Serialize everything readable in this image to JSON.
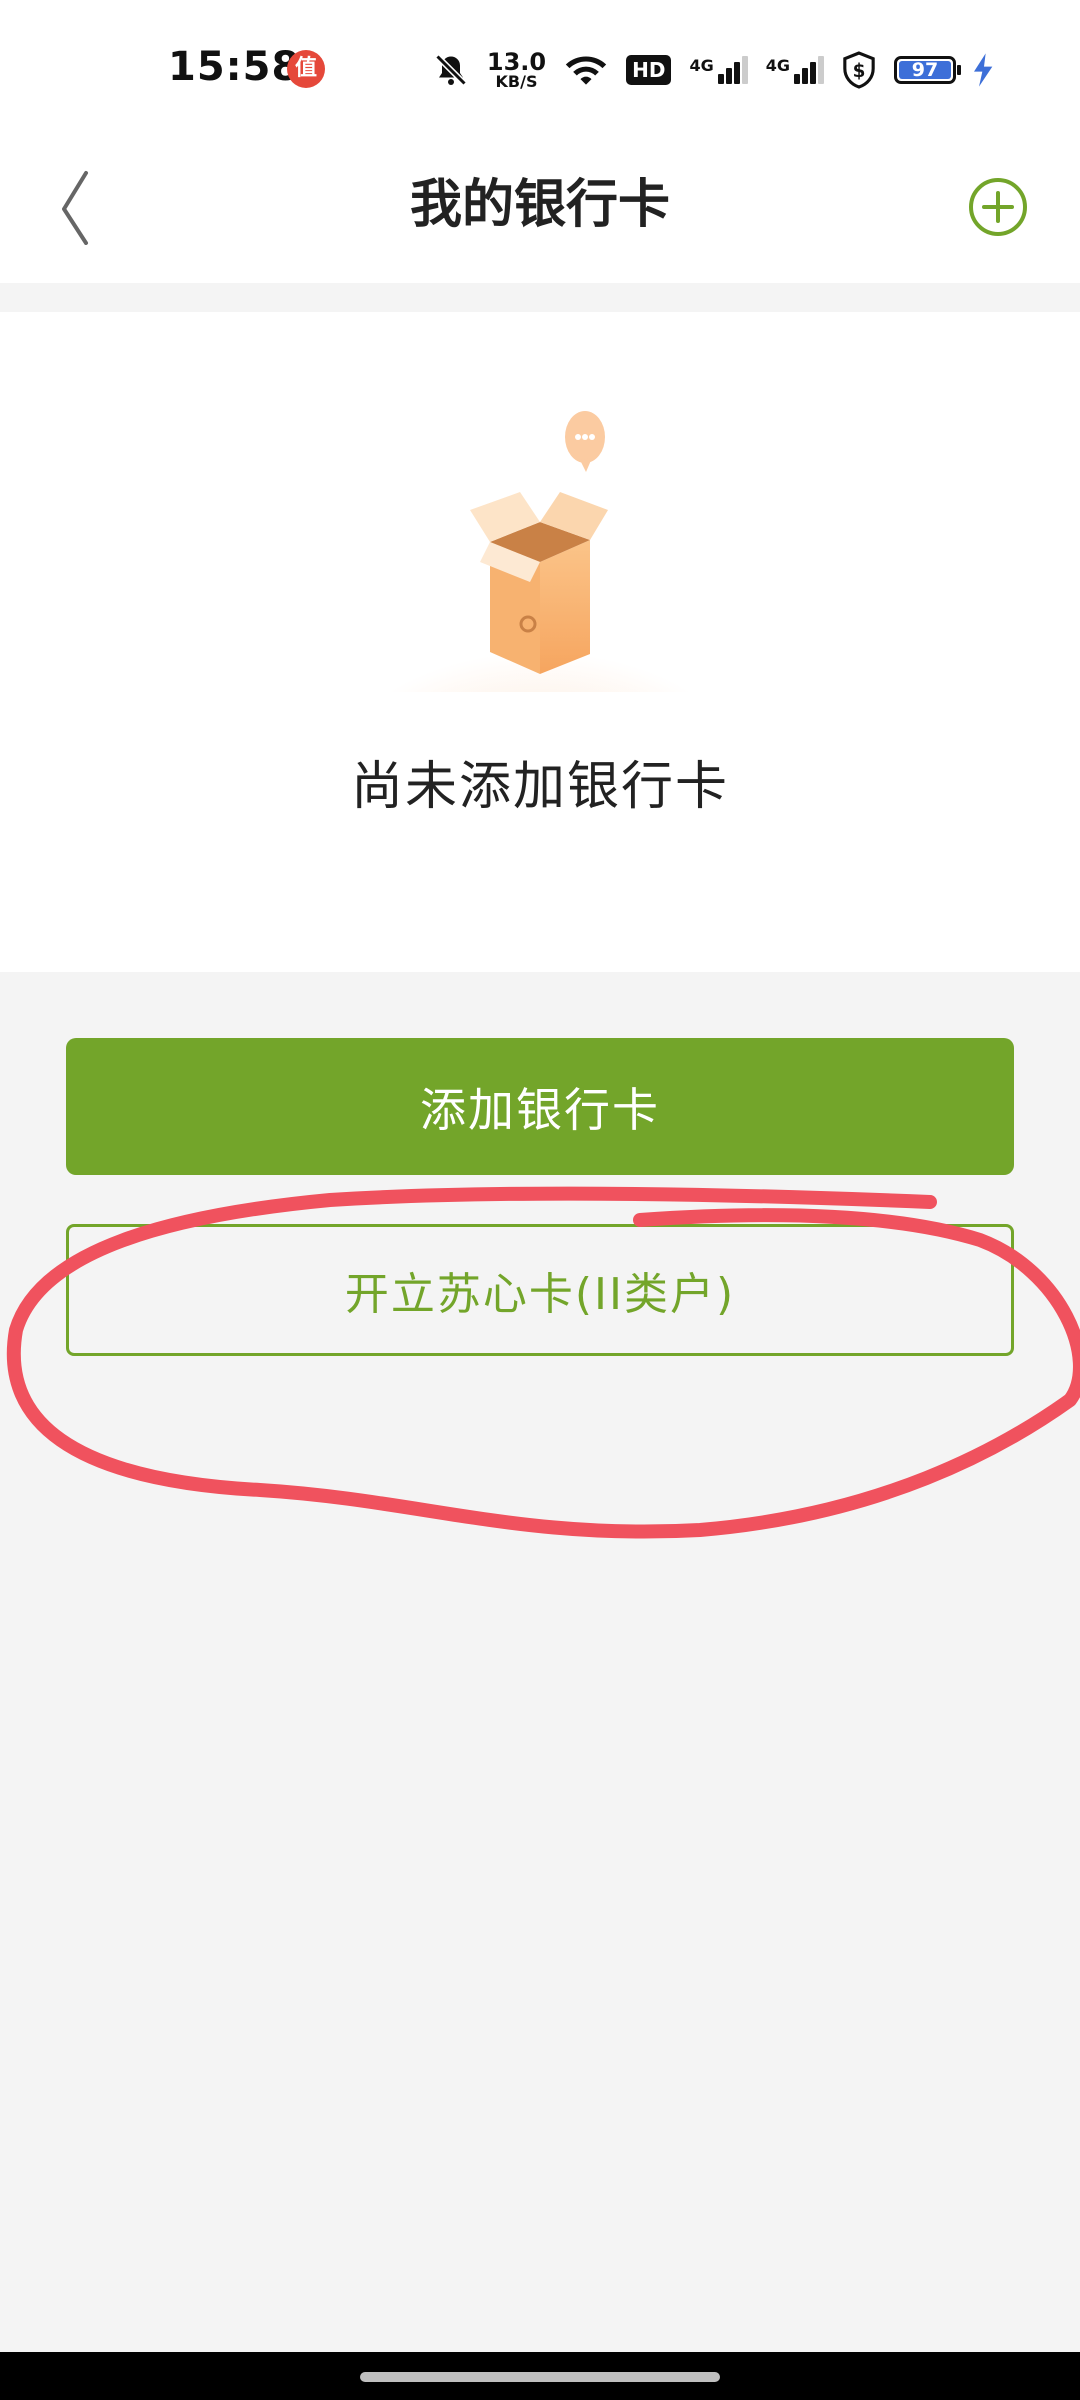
{
  "status_bar": {
    "time": "15:58",
    "app_badge": "值",
    "net_speed_value": "13.0",
    "net_speed_unit": "KB/S",
    "hd_label": "HD",
    "network_1": "4G",
    "network_2": "4G",
    "battery_level": "97"
  },
  "header": {
    "title": "我的银行卡",
    "back_icon": "chevron-left-icon",
    "add_icon": "plus-circle-icon"
  },
  "empty_state": {
    "message": "尚未添加银行卡",
    "illustration": "open-box-icon"
  },
  "actions": {
    "add_card_label": "添加银行卡",
    "open_account_label": "开立苏心卡(II类户)"
  },
  "colors": {
    "brand_green": "#73a52a",
    "annotation_red": "#f0525e",
    "battery_blue": "#3d6fd8"
  }
}
